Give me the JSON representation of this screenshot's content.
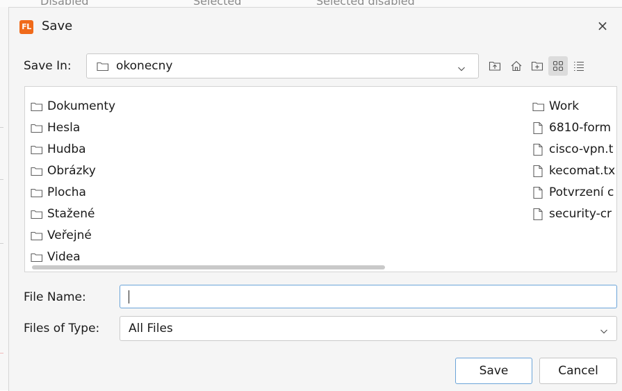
{
  "background": {
    "radio_labels": [
      "Disabled",
      "Selected",
      "Selected disabled"
    ]
  },
  "dialog": {
    "title": "Save",
    "app_icon_text": "FL",
    "close_glyph": "×"
  },
  "save_in": {
    "label": "Save In:",
    "value": "okonecny"
  },
  "toolbar": {
    "icons": [
      "up-folder-icon",
      "home-icon",
      "new-folder-icon",
      "list-view-icon",
      "details-view-icon"
    ]
  },
  "files": {
    "left_column": [
      {
        "name": "Dokumenty",
        "kind": "folder"
      },
      {
        "name": "Hesla",
        "kind": "folder"
      },
      {
        "name": "Hudba",
        "kind": "folder"
      },
      {
        "name": "Obrázky",
        "kind": "folder"
      },
      {
        "name": "Plocha",
        "kind": "folder"
      },
      {
        "name": "Stažené",
        "kind": "folder"
      },
      {
        "name": "Veřejné",
        "kind": "folder"
      },
      {
        "name": "Videa",
        "kind": "folder"
      }
    ],
    "right_column": [
      {
        "name": "Work",
        "kind": "folder"
      },
      {
        "name": "6810-form",
        "kind": "file"
      },
      {
        "name": "cisco-vpn.t",
        "kind": "file"
      },
      {
        "name": "kecomat.tx",
        "kind": "file"
      },
      {
        "name": "Potvrzení c",
        "kind": "file"
      },
      {
        "name": "security-cr",
        "kind": "file"
      }
    ]
  },
  "file_name": {
    "label": "File Name:",
    "value": ""
  },
  "file_type": {
    "label": "Files of Type:",
    "value": "All Files"
  },
  "buttons": {
    "save": "Save",
    "cancel": "Cancel"
  },
  "colors": {
    "accent": "#6aa3d8",
    "app_icon": "#f06a1a"
  }
}
